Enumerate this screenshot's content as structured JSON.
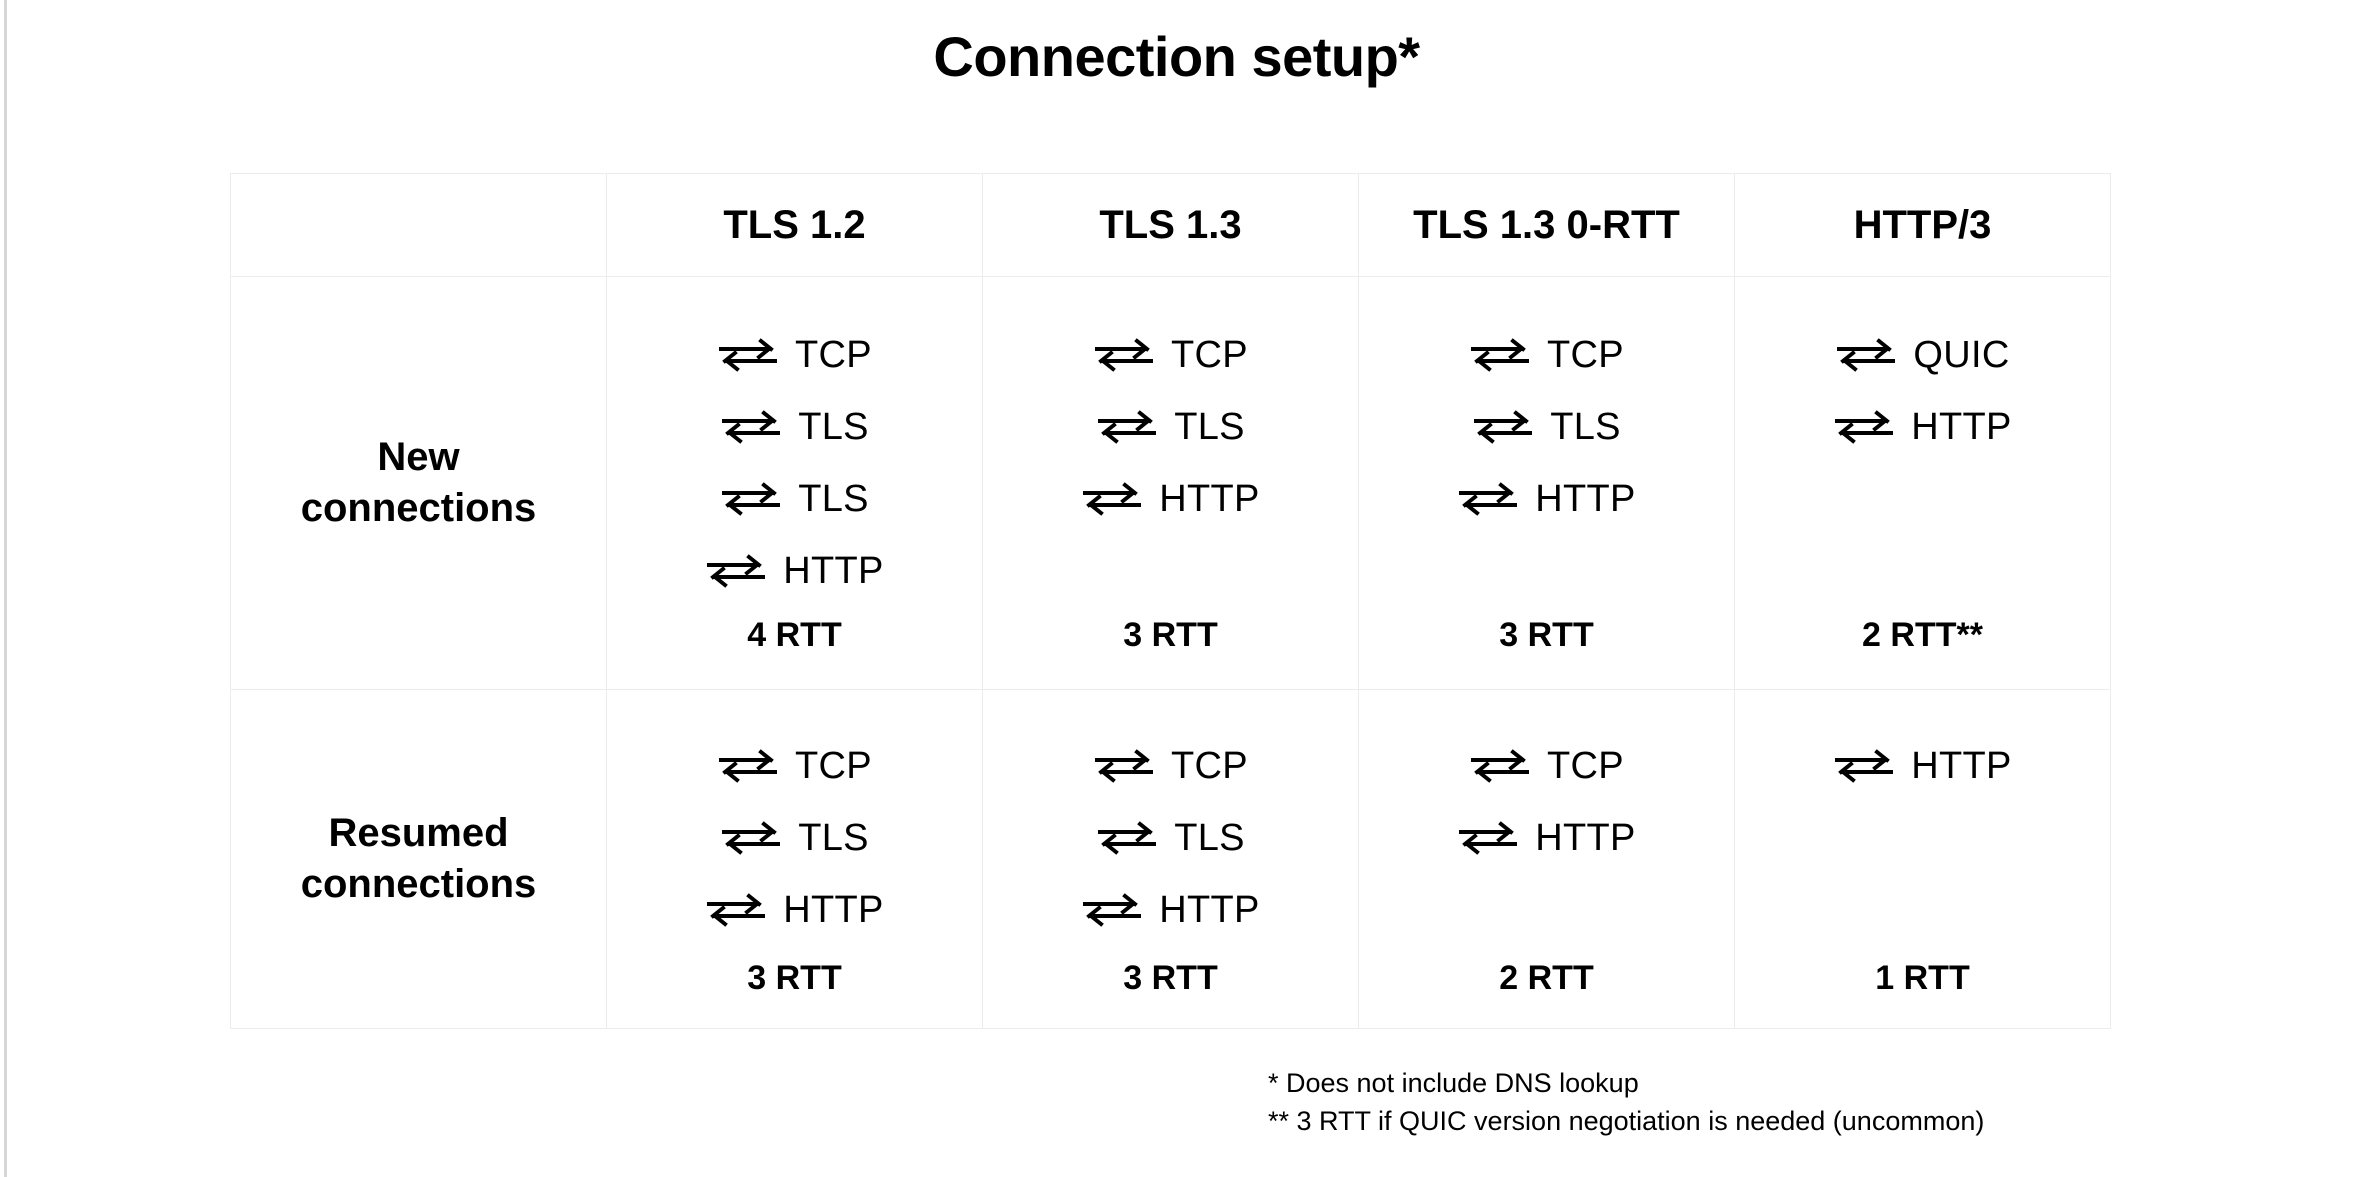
{
  "slide": {
    "title": "Connection setup*"
  },
  "table": {
    "corner_header": "",
    "column_headers": [
      "TLS 1.2",
      "TLS 1.3",
      "TLS 1.3 0-RTT",
      "HTTP/3"
    ],
    "rows": [
      {
        "label_line1": "New",
        "label_line2": "connections",
        "cells": [
          {
            "steps": [
              "TCP",
              "TLS",
              "TLS",
              "HTTP"
            ],
            "rtt": "4 RTT"
          },
          {
            "steps": [
              "TCP",
              "TLS",
              "HTTP"
            ],
            "rtt": "3 RTT"
          },
          {
            "steps": [
              "TCP",
              "TLS",
              "HTTP"
            ],
            "rtt": "3 RTT"
          },
          {
            "steps": [
              "QUIC",
              "HTTP"
            ],
            "rtt": "2 RTT**"
          }
        ]
      },
      {
        "label_line1": "Resumed",
        "label_line2": "connections",
        "cells": [
          {
            "steps": [
              "TCP",
              "TLS",
              "HTTP"
            ],
            "rtt": "3 RTT"
          },
          {
            "steps": [
              "TCP",
              "TLS",
              "HTTP"
            ],
            "rtt": "3 RTT"
          },
          {
            "steps": [
              "TCP",
              "HTTP"
            ],
            "rtt": "2 RTT"
          },
          {
            "steps": [
              "HTTP"
            ],
            "rtt": "1 RTT"
          }
        ]
      }
    ]
  },
  "footnotes": {
    "line1": "* Does not include DNS lookup",
    "line2": "** 3 RTT if QUIC version negotiation is needed (uncommon)"
  },
  "icons": {
    "roundtrip": "bidirectional-roundtrip-arrows-icon"
  },
  "colors": {
    "background": "#ffffff",
    "text": "#000000",
    "table_border": "#ececec",
    "slide_edge": "#d4d6d8"
  }
}
